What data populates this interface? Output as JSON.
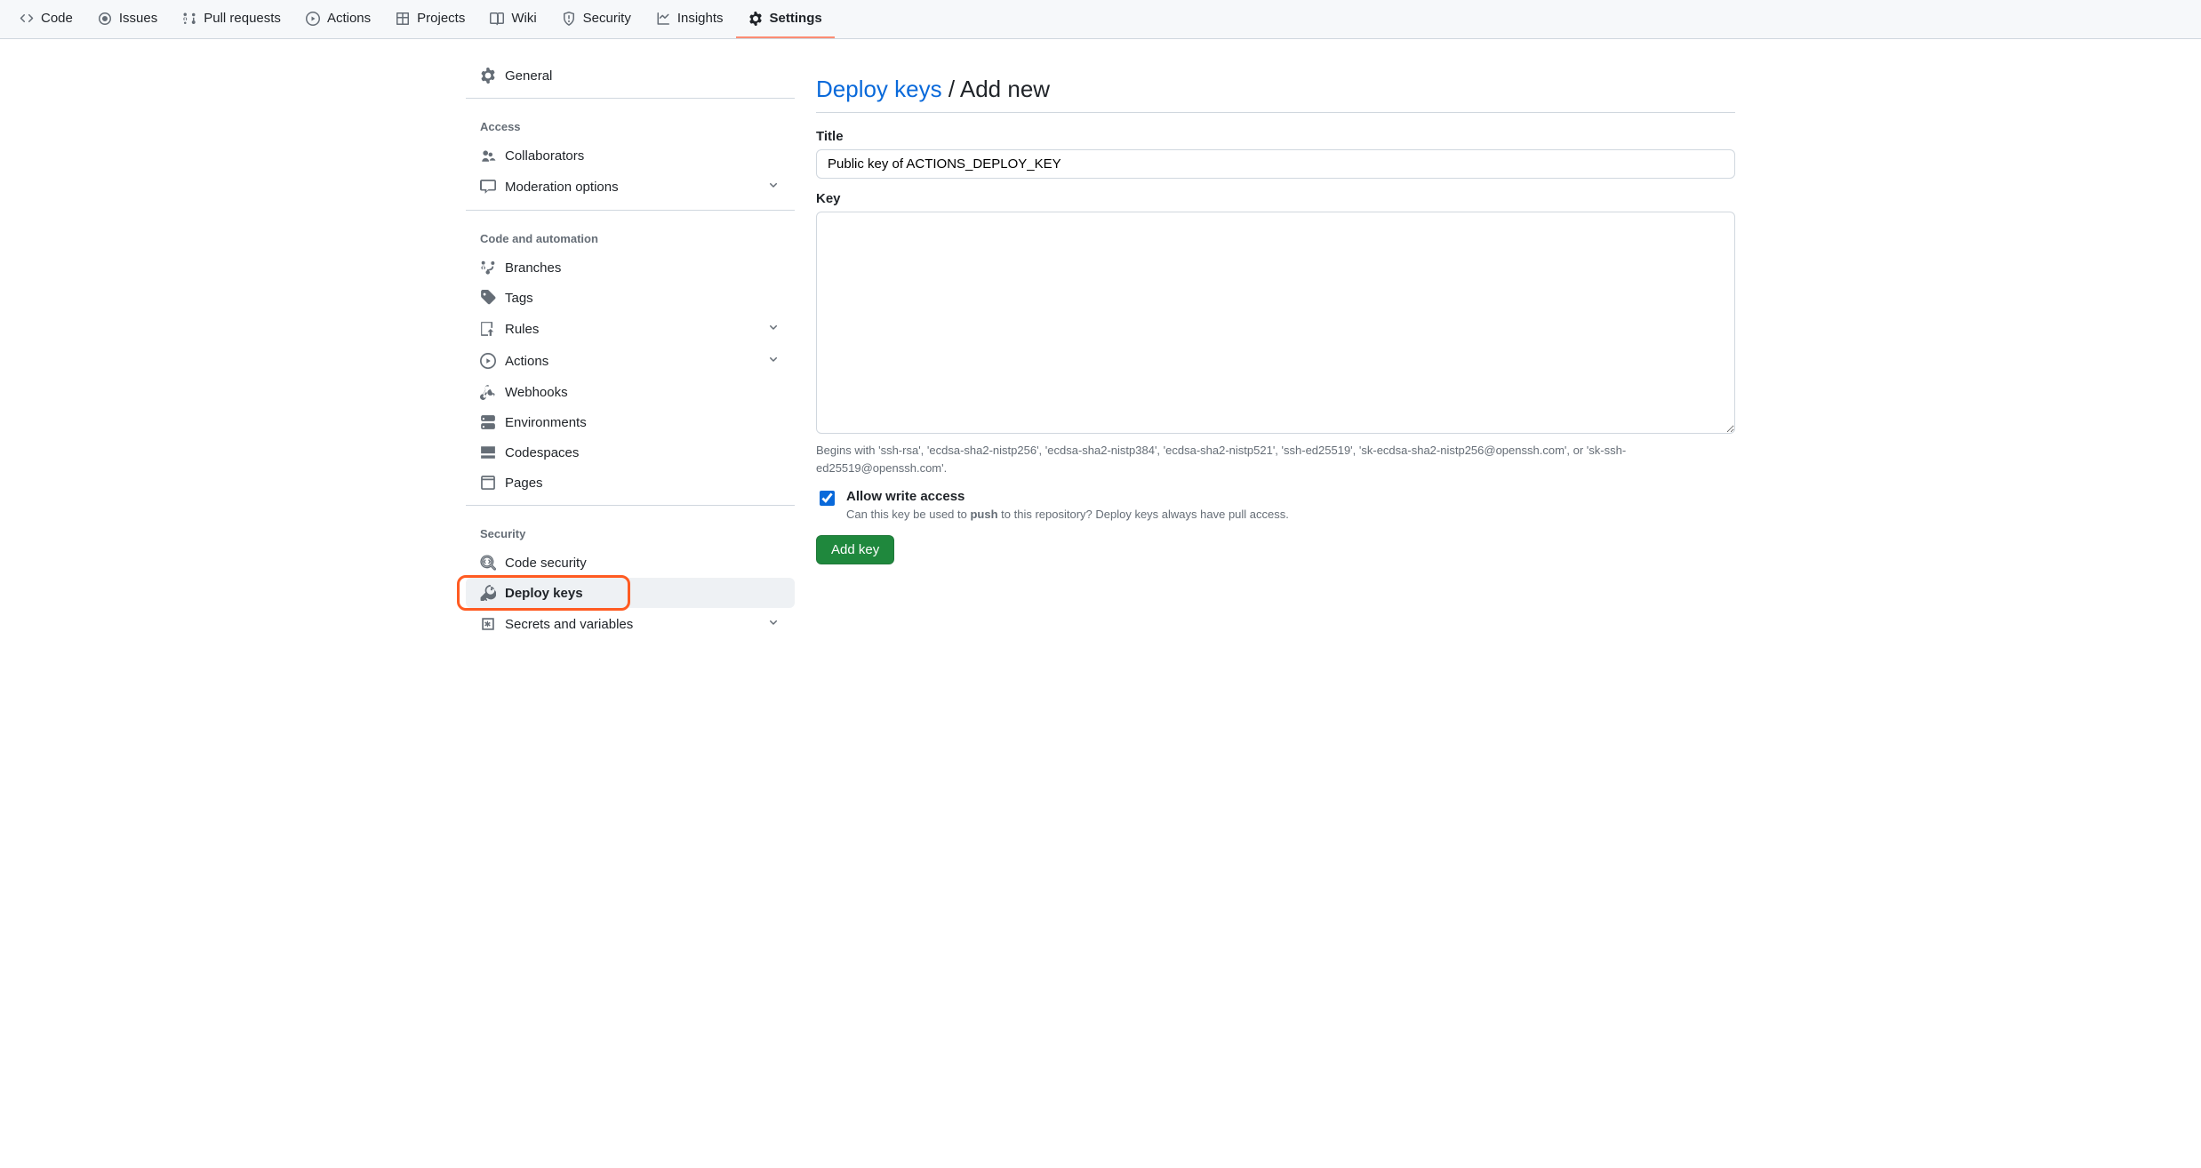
{
  "topnav": {
    "items": [
      {
        "id": "code",
        "label": "Code"
      },
      {
        "id": "issues",
        "label": "Issues"
      },
      {
        "id": "pull-requests",
        "label": "Pull requests"
      },
      {
        "id": "actions",
        "label": "Actions"
      },
      {
        "id": "projects",
        "label": "Projects"
      },
      {
        "id": "wiki",
        "label": "Wiki"
      },
      {
        "id": "security",
        "label": "Security"
      },
      {
        "id": "insights",
        "label": "Insights"
      },
      {
        "id": "settings",
        "label": "Settings"
      }
    ],
    "active": "settings"
  },
  "sidebar": {
    "general_label": "General",
    "groups": [
      {
        "heading": "Access",
        "items": [
          {
            "id": "collaborators",
            "label": "Collaborators",
            "chevron": false
          },
          {
            "id": "moderation",
            "label": "Moderation options",
            "chevron": true
          }
        ]
      },
      {
        "heading": "Code and automation",
        "items": [
          {
            "id": "branches",
            "label": "Branches",
            "chevron": false
          },
          {
            "id": "tags",
            "label": "Tags",
            "chevron": false
          },
          {
            "id": "rules",
            "label": "Rules",
            "chevron": true
          },
          {
            "id": "actions",
            "label": "Actions",
            "chevron": true
          },
          {
            "id": "webhooks",
            "label": "Webhooks",
            "chevron": false
          },
          {
            "id": "environments",
            "label": "Environments",
            "chevron": false
          },
          {
            "id": "codespaces",
            "label": "Codespaces",
            "chevron": false
          },
          {
            "id": "pages",
            "label": "Pages",
            "chevron": false
          }
        ]
      },
      {
        "heading": "Security",
        "items": [
          {
            "id": "code-security",
            "label": "Code security",
            "chevron": false
          },
          {
            "id": "deploy-keys",
            "label": "Deploy keys",
            "chevron": false,
            "active": true,
            "highlight": true
          },
          {
            "id": "secrets",
            "label": "Secrets and variables",
            "chevron": true
          }
        ]
      }
    ]
  },
  "page": {
    "breadcrumb_link": "Deploy keys",
    "breadcrumb_sep": " / ",
    "breadcrumb_leaf": "Add new",
    "title_label": "Title",
    "title_value": "Public key of ACTIONS_DEPLOY_KEY",
    "key_label": "Key",
    "key_value": "",
    "key_hint": "Begins with 'ssh-rsa', 'ecdsa-sha2-nistp256', 'ecdsa-sha2-nistp384', 'ecdsa-sha2-nistp521', 'ssh-ed25519', 'sk-ecdsa-sha2-nistp256@openssh.com', or 'sk-ssh-ed25519@openssh.com'.",
    "allow_write_checked": true,
    "allow_write_label": "Allow write access",
    "allow_write_desc_pre": "Can this key be used to ",
    "allow_write_desc_bold": "push",
    "allow_write_desc_post": " to this repository? Deploy keys always have pull access.",
    "submit_label": "Add key"
  }
}
